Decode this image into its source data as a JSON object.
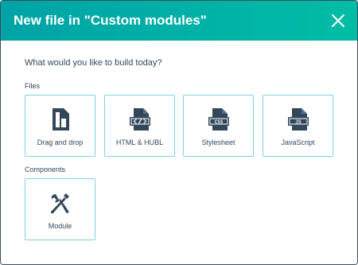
{
  "dialog": {
    "title": "New file in \"Custom modules\"",
    "close_icon": "close-icon",
    "header_color_start": "#00a3a6",
    "header_color_end": "#00bda5"
  },
  "prompt": "What would you like to build today?",
  "files": {
    "label": "Files",
    "items": [
      {
        "label": "Drag and drop",
        "icon": "drag-and-drop-icon"
      },
      {
        "label": "HTML & HUBL",
        "icon": "html-file-icon"
      },
      {
        "label": "Stylesheet",
        "icon": "css-file-icon"
      },
      {
        "label": "JavaScript",
        "icon": "js-file-icon"
      }
    ]
  },
  "components": {
    "label": "Components",
    "items": [
      {
        "label": "Module",
        "icon": "tools-icon"
      }
    ]
  },
  "colors": {
    "text": "#33475b",
    "card_border": "#7fd1de",
    "icon": "#33475b"
  }
}
